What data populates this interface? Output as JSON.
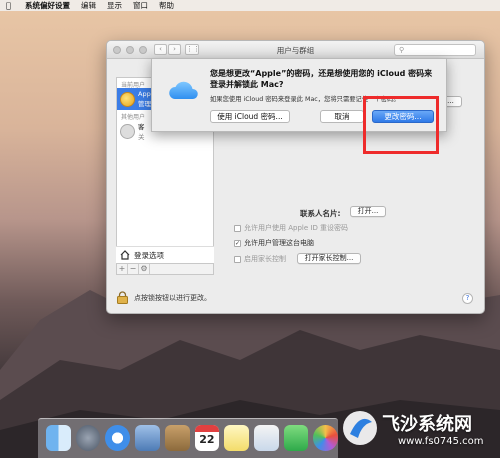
{
  "menubar": {
    "apple_icon": "apple-logo",
    "items": [
      "系统偏好设置",
      "编辑",
      "显示",
      "窗口",
      "帮助"
    ]
  },
  "window": {
    "title": "用户与群组",
    "search_placeholder": "",
    "sidebar": {
      "current_users_header": "当前用户",
      "current_user_name": "App",
      "current_user_role": "管理",
      "other_users_header": "其他用户",
      "guest_name": "客",
      "guest_status": "关"
    },
    "login_options_label": "登录选项",
    "contact_card_label": "联系人名片:",
    "open_button": "打开...",
    "partial_button": "码...",
    "checkboxes": [
      {
        "label": "允许用户使用 Apple ID 重设密码",
        "checked": false
      },
      {
        "label": "允许用户管理这台电脑",
        "checked": true
      },
      {
        "label": "启用家长控制",
        "checked": false
      }
    ],
    "parental_button": "打开家长控制...",
    "lock_text": "点按锁按钮以进行更改。",
    "help_label": "?"
  },
  "sheet": {
    "title": "您是想更改“Apple”的密码，还是想使用您的 iCloud 密码来登录并解锁此 Mac?",
    "message": "如果您使用 iCloud 密码来登录此 Mac，您将只需要记住一个密码。",
    "buttons": {
      "use_icloud": "使用 iCloud 密码...",
      "cancel": "取消",
      "change_password": "更改密码..."
    },
    "highlight_color": "#ee2b2b"
  },
  "dock": {
    "calendar_day": "22",
    "icons": [
      "finder-icon",
      "launchpad-icon",
      "safari-icon",
      "mail-icon",
      "contacts-icon",
      "calendar-icon",
      "notes-icon",
      "preview-icon",
      "facetime-icon",
      "photos-icon"
    ]
  },
  "watermark": {
    "name": "飞沙系统网",
    "url": "www.fs0745.com"
  }
}
